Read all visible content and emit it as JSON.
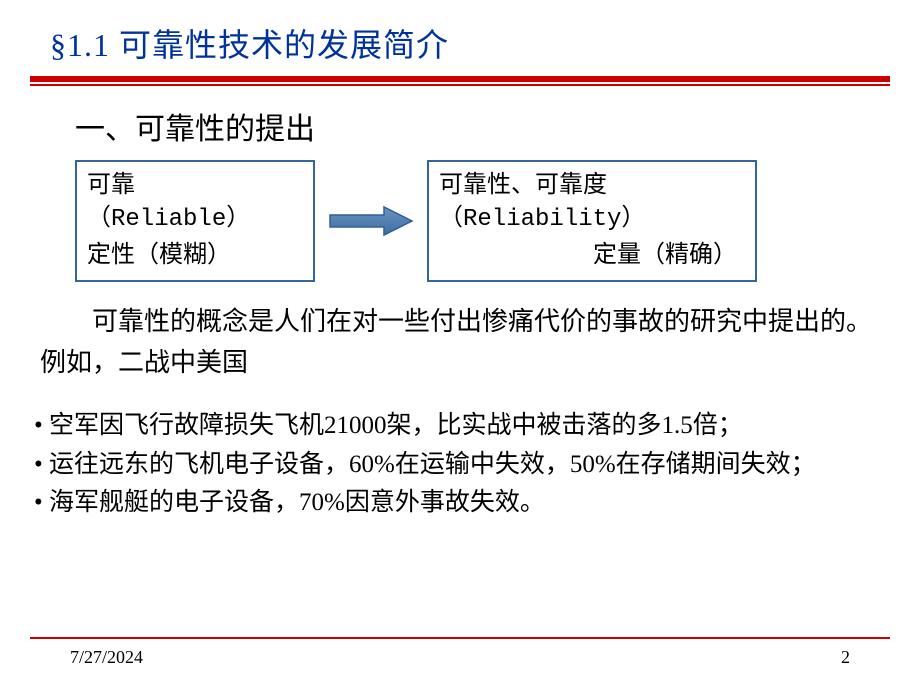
{
  "title": "§1.1 可靠性技术的发展简介",
  "subheading": "一、可靠性的提出",
  "box_left": {
    "line1": "可靠",
    "line2": "（Reliable）",
    "line3": "定性（模糊）"
  },
  "box_right": {
    "line1": "可靠性、可靠度",
    "line2": "（Reliability）",
    "line3": "定量（精确）"
  },
  "paragraph": "可靠性的概念是人们在对一些付出惨痛代价的事故的研究中提出的。例如，二战中美国",
  "bullets": {
    "b1": "• 空军因飞行故障损失飞机21000架，比实战中被击落的多1.5倍；",
    "b2": "• 运往远东的飞机电子设备，60%在运输中失效，50%在存储期间失效；",
    "b3": "• 海军舰艇的电子设备，70%因意外事故失效。"
  },
  "footer": {
    "date": "7/27/2024",
    "page": "2"
  }
}
